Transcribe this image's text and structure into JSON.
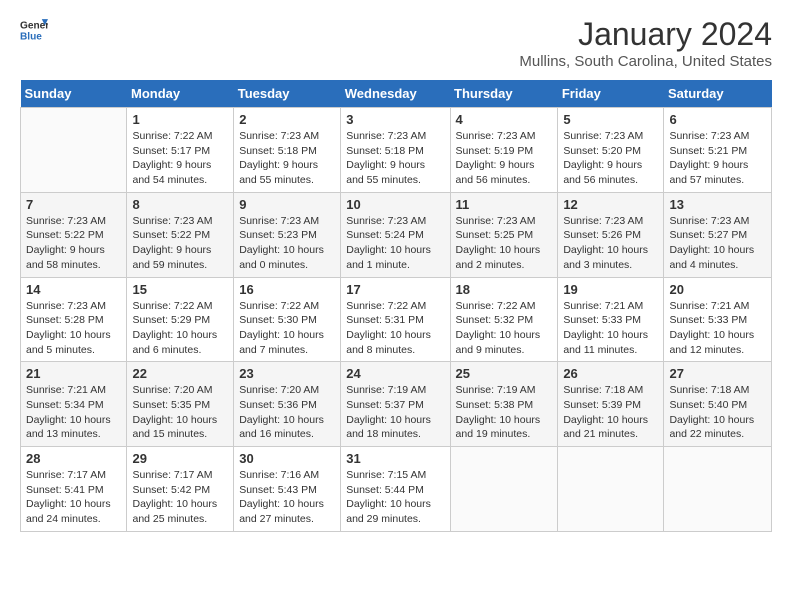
{
  "header": {
    "logo_line1": "General",
    "logo_line2": "Blue",
    "title": "January 2024",
    "subtitle": "Mullins, South Carolina, United States"
  },
  "days_of_week": [
    "Sunday",
    "Monday",
    "Tuesday",
    "Wednesday",
    "Thursday",
    "Friday",
    "Saturday"
  ],
  "weeks": [
    [
      {
        "num": "",
        "info": ""
      },
      {
        "num": "1",
        "info": "Sunrise: 7:22 AM\nSunset: 5:17 PM\nDaylight: 9 hours\nand 54 minutes."
      },
      {
        "num": "2",
        "info": "Sunrise: 7:23 AM\nSunset: 5:18 PM\nDaylight: 9 hours\nand 55 minutes."
      },
      {
        "num": "3",
        "info": "Sunrise: 7:23 AM\nSunset: 5:18 PM\nDaylight: 9 hours\nand 55 minutes."
      },
      {
        "num": "4",
        "info": "Sunrise: 7:23 AM\nSunset: 5:19 PM\nDaylight: 9 hours\nand 56 minutes."
      },
      {
        "num": "5",
        "info": "Sunrise: 7:23 AM\nSunset: 5:20 PM\nDaylight: 9 hours\nand 56 minutes."
      },
      {
        "num": "6",
        "info": "Sunrise: 7:23 AM\nSunset: 5:21 PM\nDaylight: 9 hours\nand 57 minutes."
      }
    ],
    [
      {
        "num": "7",
        "info": "Sunrise: 7:23 AM\nSunset: 5:22 PM\nDaylight: 9 hours\nand 58 minutes."
      },
      {
        "num": "8",
        "info": "Sunrise: 7:23 AM\nSunset: 5:22 PM\nDaylight: 9 hours\nand 59 minutes."
      },
      {
        "num": "9",
        "info": "Sunrise: 7:23 AM\nSunset: 5:23 PM\nDaylight: 10 hours\nand 0 minutes."
      },
      {
        "num": "10",
        "info": "Sunrise: 7:23 AM\nSunset: 5:24 PM\nDaylight: 10 hours\nand 1 minute."
      },
      {
        "num": "11",
        "info": "Sunrise: 7:23 AM\nSunset: 5:25 PM\nDaylight: 10 hours\nand 2 minutes."
      },
      {
        "num": "12",
        "info": "Sunrise: 7:23 AM\nSunset: 5:26 PM\nDaylight: 10 hours\nand 3 minutes."
      },
      {
        "num": "13",
        "info": "Sunrise: 7:23 AM\nSunset: 5:27 PM\nDaylight: 10 hours\nand 4 minutes."
      }
    ],
    [
      {
        "num": "14",
        "info": "Sunrise: 7:23 AM\nSunset: 5:28 PM\nDaylight: 10 hours\nand 5 minutes."
      },
      {
        "num": "15",
        "info": "Sunrise: 7:22 AM\nSunset: 5:29 PM\nDaylight: 10 hours\nand 6 minutes."
      },
      {
        "num": "16",
        "info": "Sunrise: 7:22 AM\nSunset: 5:30 PM\nDaylight: 10 hours\nand 7 minutes."
      },
      {
        "num": "17",
        "info": "Sunrise: 7:22 AM\nSunset: 5:31 PM\nDaylight: 10 hours\nand 8 minutes."
      },
      {
        "num": "18",
        "info": "Sunrise: 7:22 AM\nSunset: 5:32 PM\nDaylight: 10 hours\nand 9 minutes."
      },
      {
        "num": "19",
        "info": "Sunrise: 7:21 AM\nSunset: 5:33 PM\nDaylight: 10 hours\nand 11 minutes."
      },
      {
        "num": "20",
        "info": "Sunrise: 7:21 AM\nSunset: 5:33 PM\nDaylight: 10 hours\nand 12 minutes."
      }
    ],
    [
      {
        "num": "21",
        "info": "Sunrise: 7:21 AM\nSunset: 5:34 PM\nDaylight: 10 hours\nand 13 minutes."
      },
      {
        "num": "22",
        "info": "Sunrise: 7:20 AM\nSunset: 5:35 PM\nDaylight: 10 hours\nand 15 minutes."
      },
      {
        "num": "23",
        "info": "Sunrise: 7:20 AM\nSunset: 5:36 PM\nDaylight: 10 hours\nand 16 minutes."
      },
      {
        "num": "24",
        "info": "Sunrise: 7:19 AM\nSunset: 5:37 PM\nDaylight: 10 hours\nand 18 minutes."
      },
      {
        "num": "25",
        "info": "Sunrise: 7:19 AM\nSunset: 5:38 PM\nDaylight: 10 hours\nand 19 minutes."
      },
      {
        "num": "26",
        "info": "Sunrise: 7:18 AM\nSunset: 5:39 PM\nDaylight: 10 hours\nand 21 minutes."
      },
      {
        "num": "27",
        "info": "Sunrise: 7:18 AM\nSunset: 5:40 PM\nDaylight: 10 hours\nand 22 minutes."
      }
    ],
    [
      {
        "num": "28",
        "info": "Sunrise: 7:17 AM\nSunset: 5:41 PM\nDaylight: 10 hours\nand 24 minutes."
      },
      {
        "num": "29",
        "info": "Sunrise: 7:17 AM\nSunset: 5:42 PM\nDaylight: 10 hours\nand 25 minutes."
      },
      {
        "num": "30",
        "info": "Sunrise: 7:16 AM\nSunset: 5:43 PM\nDaylight: 10 hours\nand 27 minutes."
      },
      {
        "num": "31",
        "info": "Sunrise: 7:15 AM\nSunset: 5:44 PM\nDaylight: 10 hours\nand 29 minutes."
      },
      {
        "num": "",
        "info": ""
      },
      {
        "num": "",
        "info": ""
      },
      {
        "num": "",
        "info": ""
      }
    ]
  ]
}
